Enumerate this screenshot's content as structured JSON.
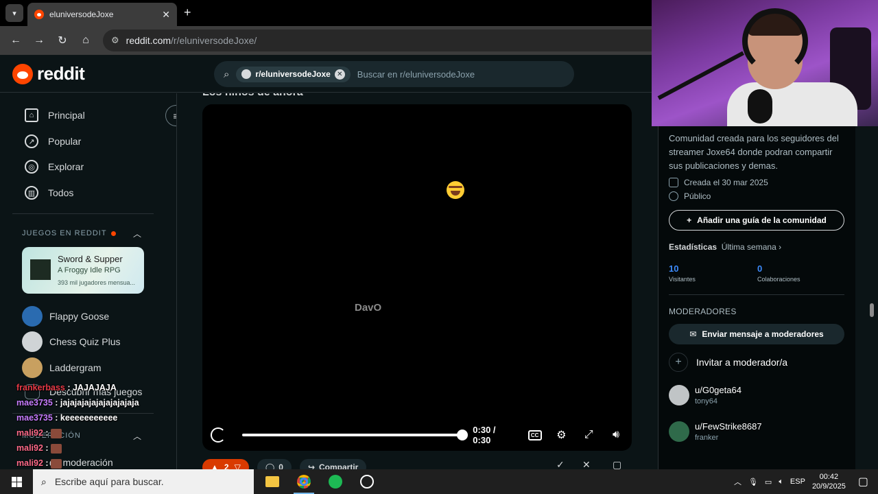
{
  "browser": {
    "tab_title": "eluniversodeJoxe",
    "url_host": "reddit.com",
    "url_path": "/r/eluniversodeJoxe/"
  },
  "reddit": {
    "logo_text": "reddit",
    "search_chip": "r/eluniversodeJoxe",
    "search_placeholder": "Buscar en r/eluniversodeJoxe"
  },
  "sidebar": {
    "nav": [
      {
        "label": "Principal",
        "icon": "home-icon"
      },
      {
        "label": "Popular",
        "icon": "popular-icon"
      },
      {
        "label": "Explorar",
        "icon": "explore-icon"
      },
      {
        "label": "Todos",
        "icon": "all-icon"
      }
    ],
    "games_header": "JUEGOS EN REDDIT",
    "featured_game": {
      "title": "Sword & Supper",
      "subtitle": "A Froggy Idle RPG",
      "players": "393 mil jugadores mensua..."
    },
    "games": [
      "Flappy Goose",
      "Chess Quiz Plus",
      "Laddergram"
    ],
    "discover": "Descubrir más juegos",
    "moderation_header": "MODERACIÓN",
    "moderation_item": "de moderación"
  },
  "chat": [
    {
      "user": "frankerbass",
      "text": " : JAJAJAJA"
    },
    {
      "user": "mae3735",
      "text": " : jajajajajajajajajajaja"
    },
    {
      "user": "mae3735",
      "text": " : keeeeeeeeeee"
    },
    {
      "user": "mali92",
      "text": " : "
    },
    {
      "user": "mali92",
      "text": " : "
    },
    {
      "user": "mali92",
      "text": " : "
    }
  ],
  "post": {
    "title": "Los niños de ahora",
    "watermark": "DavO",
    "time_display": "0:30 / 0:30",
    "progress_fraction": 1.0,
    "votes": "2",
    "comments": "0",
    "share_label": "Compartir"
  },
  "community": {
    "description": "Comunidad creada para los seguidores del streamer Joxe64 donde podran compartir sus publicaciones y demas.",
    "created": "Creada el 30 mar 2025",
    "visibility": "Público",
    "guide_button": "Añadir una guía de la comunidad",
    "stats_label": "Estadísticas",
    "stats_period": "Última semana ›",
    "visitors_value": "10",
    "visitors_label": "Visitantes",
    "contributions_value": "0",
    "contributions_label": "Colaboraciones",
    "moderators_header": "MODERADORES",
    "message_mods_button": "Enviar mensaje a moderadores",
    "invite_mod": "Invitar a moderador/a",
    "moderators": [
      {
        "name": "u/G0geta64",
        "flair": "tony64"
      },
      {
        "name": "u/FewStrike8687",
        "flair": "franker"
      }
    ]
  },
  "taskbar": {
    "search_placeholder": "Escribe aquí para buscar.",
    "lang": "ESP",
    "time": "00:42",
    "date": "20/9/2025"
  },
  "colors": {
    "reddit_orange": "#ff4500",
    "background": "#0b1416",
    "link_blue": "#3d8bfd"
  }
}
